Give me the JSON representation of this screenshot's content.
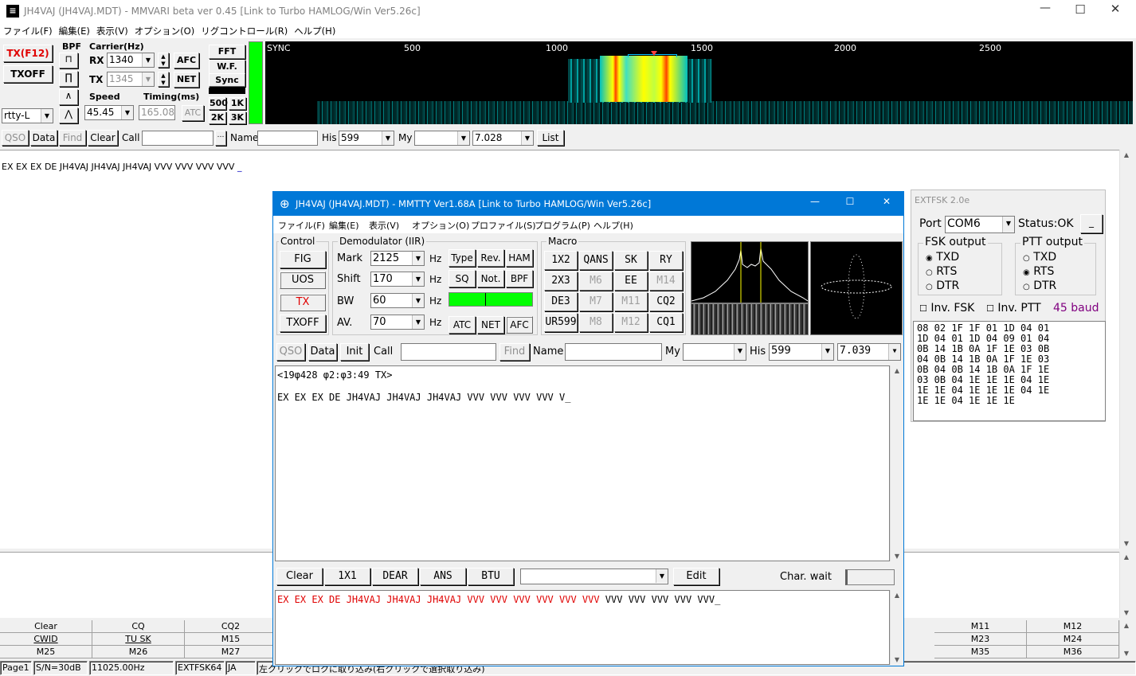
{
  "app": {
    "title": "JH4VAJ (JH4VAJ.MDT) - MMVARI beta ver 0.45 [Link to Turbo HAMLOG/Win Ver5.26c]",
    "menu": [
      "ファイル(F)",
      "編集(E)",
      "表示(V)",
      "オプション(O)",
      "リグコントロール(R)",
      "ヘルプ(H)"
    ]
  },
  "controls": {
    "tx_label": "TX(F12)",
    "txoff_label": "TXOFF",
    "mode": "rtty-L",
    "bpf_label": "BPF",
    "carrier_label": "Carrier(Hz)",
    "rx_label": "RX",
    "rx_value": "1340",
    "tx_label2": "TX",
    "tx_value": "1345",
    "afc": "AFC",
    "net": "NET",
    "speed_label": "Speed",
    "speed_value": "45.45",
    "timing_label": "Timing(ms)",
    "timing_value": "165.08",
    "atc": "ATC",
    "fft": "FFT",
    "wf": "W.F.",
    "sync": "Sync",
    "bw500": "500",
    "bw1k": "1K",
    "bw2k": "2K",
    "bw3k": "3K"
  },
  "spectrum": {
    "sync_label": "SYNC",
    "ticks": [
      "500",
      "1000",
      "1500",
      "2000",
      "2500"
    ]
  },
  "qso_bar": {
    "qso": "QSO",
    "data": "Data",
    "find": "Find",
    "clear": "Clear",
    "call": "Call",
    "name": "Name",
    "his": "His",
    "his_value": "599",
    "my": "My",
    "freq": "7.028",
    "list": "List"
  },
  "rx_text": "EX EX EX DE JH4VAJ JH4VAJ JH4VAJ VVV VVV VVV VVV",
  "macros_row1": [
    "Clear",
    "CQ",
    "CQ2",
    "",
    "",
    "",
    "",
    "",
    "",
    "",
    "M11",
    "M12"
  ],
  "macros_row2": [
    "CWID",
    "TU SK",
    "M15",
    "",
    "",
    "",
    "",
    "",
    "",
    "",
    "M23",
    "M24"
  ],
  "macros_row3": [
    "M25",
    "M26",
    "M27",
    "",
    "",
    "",
    "",
    "",
    "",
    "",
    "M35",
    "M36"
  ],
  "status": {
    "page": "Page1",
    "sn": "S/N=30dB",
    "clock": "11025.00Hz",
    "ext": "EXTFSK64",
    "ja": "JA",
    "hint": "左クリックでロクに取り込み(右クリックで選択取り込み)"
  },
  "mmtty": {
    "title": "JH4VAJ (JH4VAJ.MDT) - MMTTY Ver1.68A [Link to Turbo HAMLOG/Win Ver5.26c]",
    "menu": [
      "ファイル(F)",
      "編集(E)",
      "表示(V)",
      "オプション(O)",
      "プロファイル(S)",
      "プログラム(P)",
      "ヘルプ(H)"
    ],
    "control_label": "Control",
    "fig": "FIG",
    "uos": "UOS",
    "tx": "TX",
    "txoff": "TXOFF",
    "demod_label": "Demodulator (IIR)",
    "mark_label": "Mark",
    "mark_value": "2125",
    "shift_label": "Shift",
    "shift_value": "170",
    "bw_label": "BW",
    "bw_value": "60",
    "av_label": "AV.",
    "av_value": "70",
    "hz": "Hz",
    "type": "Type",
    "rev": "Rev.",
    "ham": "HAM",
    "sq": "SQ",
    "not": "Not.",
    "bpf": "BPF",
    "atc": "ATC",
    "net": "NET",
    "afc": "AFC",
    "macro_label": "Macro",
    "macros": [
      [
        "1X2",
        "QANS",
        "SK",
        "RY"
      ],
      [
        "2X3",
        "M6",
        "EE",
        "M14"
      ],
      [
        "DE3",
        "M7",
        "M11",
        "CQ2"
      ],
      [
        "UR599",
        "M8",
        "M12",
        "CQ1"
      ]
    ],
    "qso": "QSO",
    "data": "Data",
    "init": "Init",
    "call": "Call",
    "find": "Find",
    "name": "Name",
    "my": "My",
    "his": "His",
    "his_value": "599",
    "freq": "7.039",
    "rx_line1": "<19φ428 φ2:φ3:49 TX>",
    "rx_line2": "EX EX EX DE JH4VAJ JH4VAJ JH4VAJ VVV VVV VVV VVV V",
    "btn_clear": "Clear",
    "btn_1x1": "1X1",
    "btn_dear": "DEAR",
    "btn_ans": "ANS",
    "btn_btu": "BTU",
    "btn_edit": "Edit",
    "char_wait": "Char. wait",
    "tx_sent": "EX EX EX DE JH4VAJ JH4VAJ JH4VAJ VVV VVV VVV VVV VVV VVV",
    "tx_pending": " VVV VVV VVV VVV VVV"
  },
  "extfsk": {
    "title": "EXTFSK 2.0e",
    "port_label": "Port",
    "port_value": "COM6",
    "status": "Status:OK",
    "status_btn": "_",
    "fsk_label": "FSK output",
    "fsk_opts": [
      "TXD",
      "RTS",
      "DTR"
    ],
    "ptt_label": "PTT output",
    "ptt_opts": [
      "TXD",
      "RTS",
      "DTR"
    ],
    "inv_fsk": "Inv. FSK",
    "inv_ptt": "Inv. PTT",
    "baud": "45 baud",
    "hex": [
      "08 02 1F 1F 01 1D 04 01",
      "1D 04 01 1D 04 09 01 04",
      "0B 14 1B 0A 1F 1E 03 0B",
      "04 0B 14 1B 0A 1F 1E 03",
      "0B 04 0B 14 1B 0A 1F 1E",
      "03 0B 04 1E 1E 1E 04 1E",
      "1E 1E 04 1E 1E 1E 04 1E",
      "1E 1E 04 1E 1E 1E"
    ]
  },
  "colors": {
    "tx_red": "#e00000",
    "level_green": "#00ff00",
    "mmtty_title": "#0078d7",
    "baud": "#800080"
  }
}
